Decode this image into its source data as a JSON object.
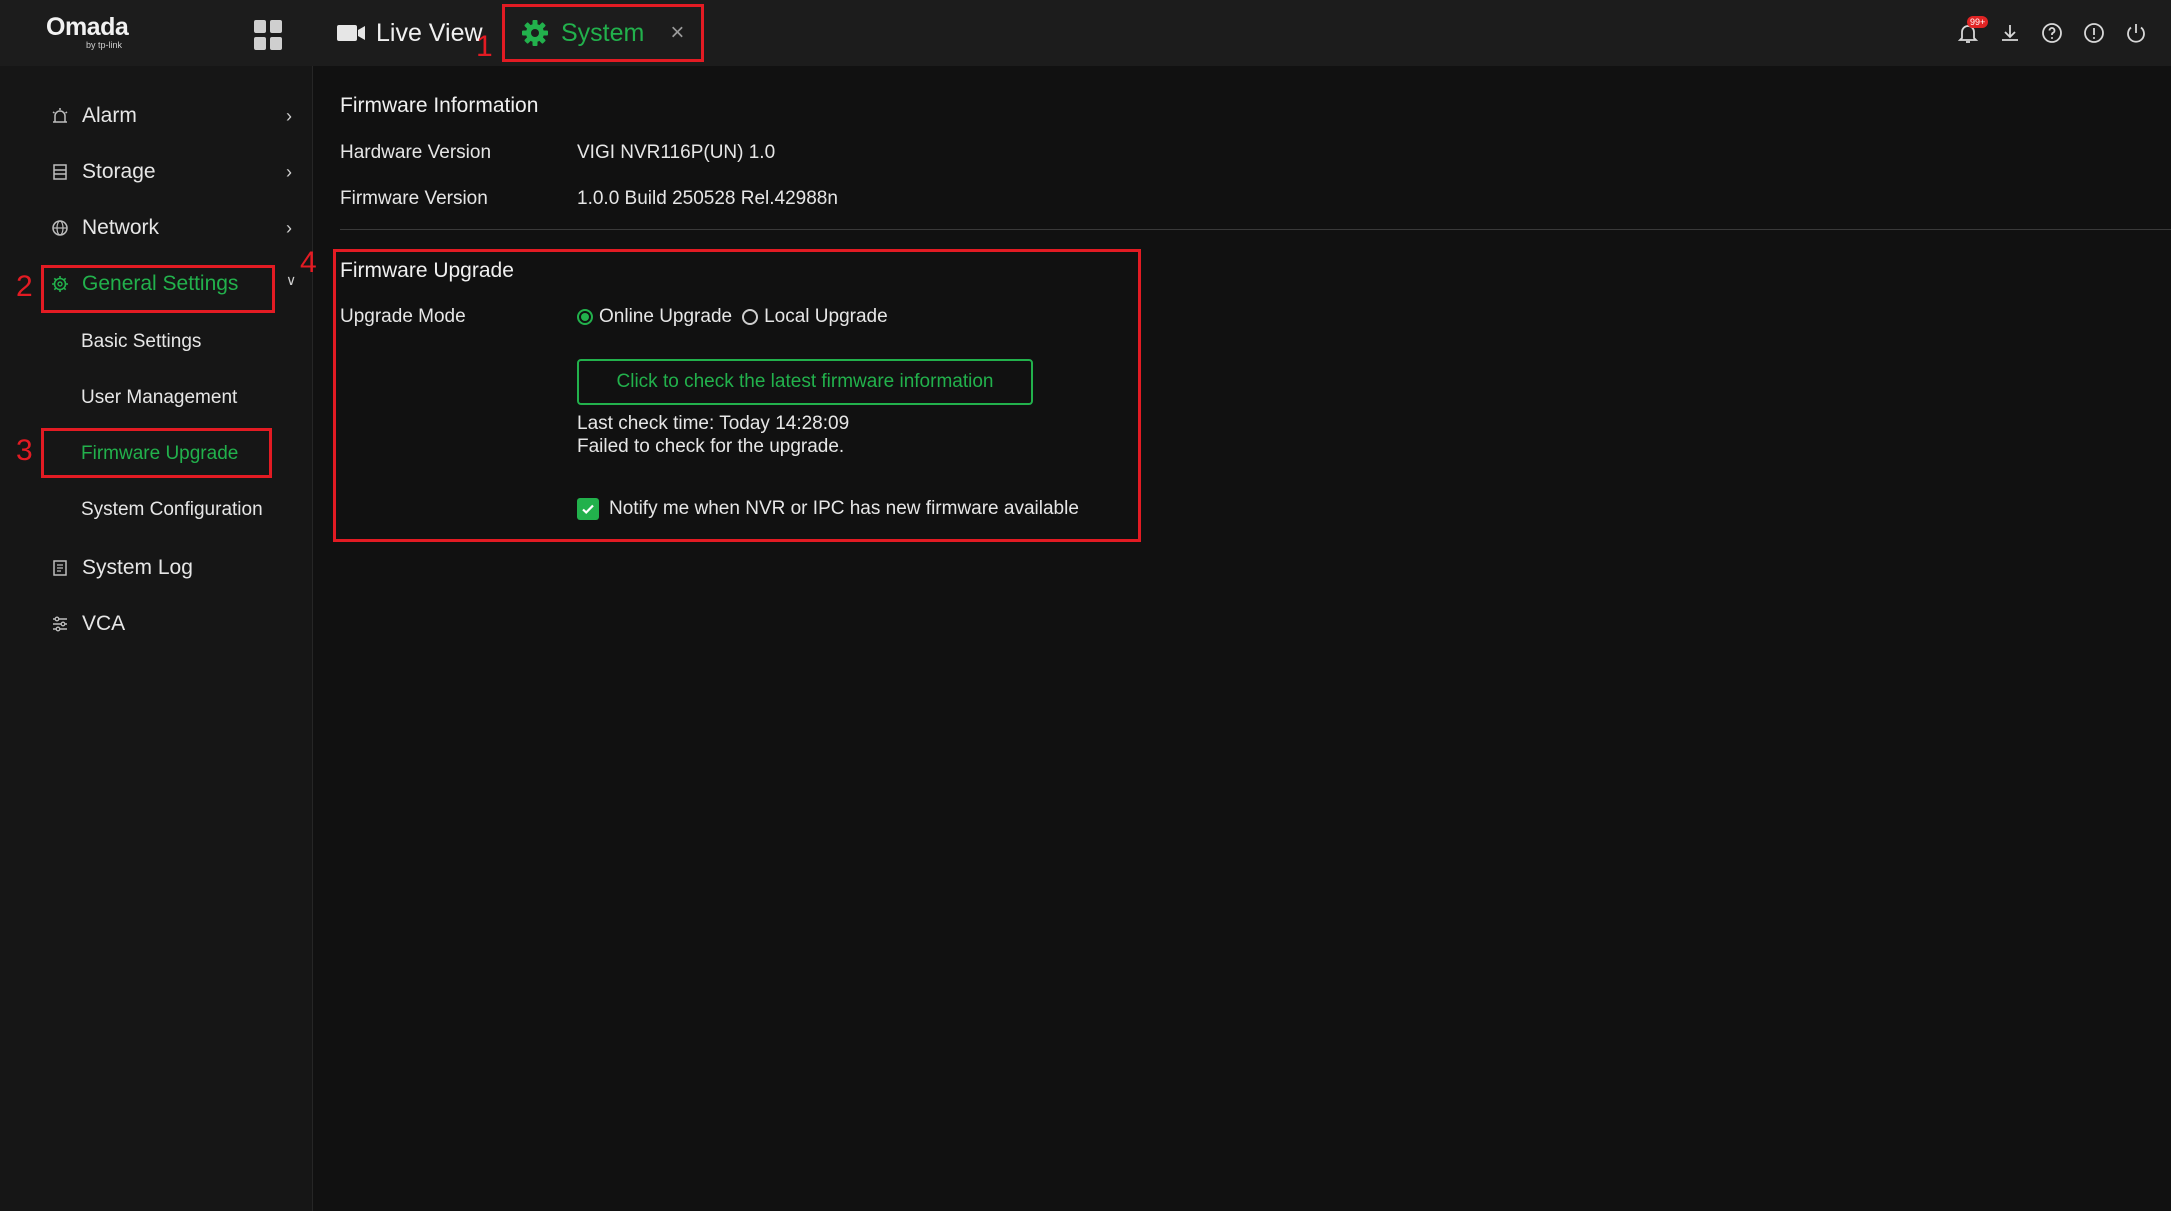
{
  "topbar": {
    "logo_main": "Omada",
    "logo_sub": "by tp-link",
    "tabs": [
      {
        "label": "Live View",
        "icon": "camera-icon"
      },
      {
        "label": "System",
        "icon": "gear-icon",
        "close": "×"
      }
    ],
    "notification_badge": "99+",
    "icons": [
      "bell-icon",
      "download-icon",
      "help-icon",
      "info-icon",
      "power-icon"
    ]
  },
  "annotations": [
    "1",
    "2",
    "3",
    "4"
  ],
  "sidebar": {
    "items": [
      {
        "label": "Alarm",
        "icon": "alarm-icon"
      },
      {
        "label": "Storage",
        "icon": "storage-icon"
      },
      {
        "label": "Network",
        "icon": "globe-icon"
      },
      {
        "label": "General Settings",
        "icon": "gear-icon"
      },
      {
        "label": "System Log",
        "icon": "log-icon"
      },
      {
        "label": "VCA",
        "icon": "sliders-icon"
      }
    ],
    "sub_items": [
      "Basic Settings",
      "User Management",
      "Firmware Upgrade",
      "System Configuration"
    ]
  },
  "firmware_info": {
    "title": "Firmware Information",
    "hardware_label": "Hardware Version",
    "hardware_value": "VIGI NVR116P(UN) 1.0",
    "firmware_label": "Firmware Version",
    "firmware_value": "1.0.0 Build 250528 Rel.42988n"
  },
  "firmware_upgrade": {
    "title": "Firmware Upgrade",
    "mode_label": "Upgrade Mode",
    "modes": [
      "Online Upgrade",
      "Local Upgrade"
    ],
    "selected_mode": "Online Upgrade",
    "check_button": "Click to check the latest firmware information",
    "last_check": "Last check time: Today 14:28:09",
    "check_result": "Failed to check for the upgrade.",
    "notify_label": "Notify me when NVR or IPC has new firmware available",
    "notify_checked": true
  },
  "colors": {
    "accent": "#22b14c",
    "annotation": "#e31b23",
    "background": "#111111"
  }
}
